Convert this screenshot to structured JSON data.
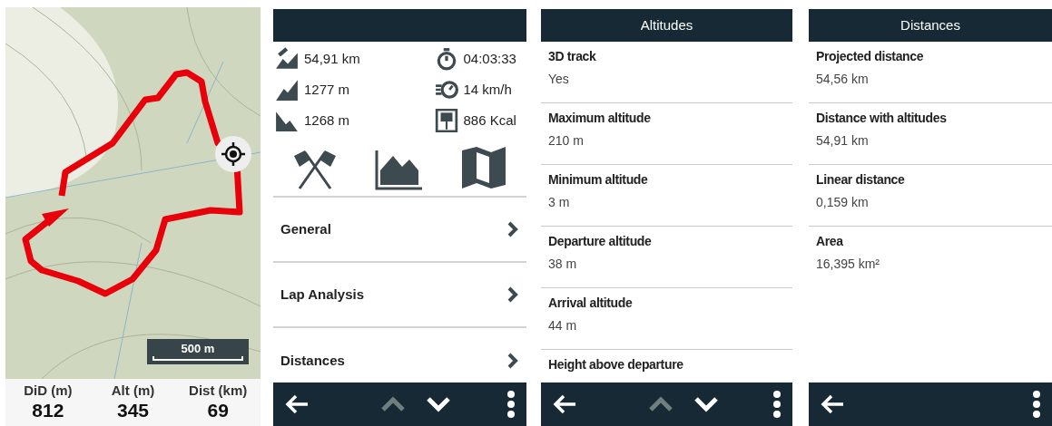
{
  "map_screen": {
    "scale": "500 m",
    "fields": [
      {
        "label": "DiD (m)",
        "value": "812"
      },
      {
        "label": "Alt (m)",
        "value": "345"
      },
      {
        "label": "Dist (km)",
        "value": "69"
      }
    ]
  },
  "track_screen": {
    "stats": [
      {
        "kind": "distance",
        "value": "54,91 km"
      },
      {
        "kind": "time",
        "value": "04:03:33"
      },
      {
        "kind": "ascent",
        "value": "1277 m"
      },
      {
        "kind": "speed",
        "value": "14 km/h"
      },
      {
        "kind": "descent",
        "value": "1268 m"
      },
      {
        "kind": "calories",
        "value": "886 Kcal"
      }
    ],
    "shortcuts": [
      {
        "kind": "flags"
      },
      {
        "kind": "profile"
      },
      {
        "kind": "map"
      }
    ],
    "menu": [
      {
        "label": "General"
      },
      {
        "label": "Lap Analysis"
      },
      {
        "label": "Distances"
      }
    ],
    "toolbar": [
      {
        "kind": "back",
        "disabled": false
      },
      {
        "kind": "up",
        "disabled": true
      },
      {
        "kind": "down",
        "disabled": false
      },
      {
        "kind": "more",
        "disabled": false
      }
    ]
  },
  "altitudes_screen": {
    "title": "Altitudes",
    "items": [
      {
        "label": "3D track",
        "value": "Yes"
      },
      {
        "label": "Maximum altitude",
        "value": "210 m"
      },
      {
        "label": "Minimum altitude",
        "value": "3 m"
      },
      {
        "label": "Departure altitude",
        "value": "38 m"
      },
      {
        "label": "Arrival altitude",
        "value": "44 m"
      },
      {
        "label": "Height above departure"
      }
    ],
    "toolbar": [
      {
        "kind": "back",
        "disabled": false
      },
      {
        "kind": "up",
        "disabled": true
      },
      {
        "kind": "down",
        "disabled": false
      },
      {
        "kind": "more",
        "disabled": false
      }
    ]
  },
  "distances_screen": {
    "title": "Distances",
    "items": [
      {
        "label": "Projected distance",
        "value": "54,56 km"
      },
      {
        "label": "Distance with altitudes",
        "value": "54,91 km"
      },
      {
        "label": "Linear distance",
        "value": "0,159 km"
      },
      {
        "label": "Area",
        "value": "16,395 km²"
      }
    ],
    "toolbar": [
      {
        "kind": "back",
        "disabled": false
      },
      {
        "kind": "more",
        "disabled": false
      }
    ]
  }
}
